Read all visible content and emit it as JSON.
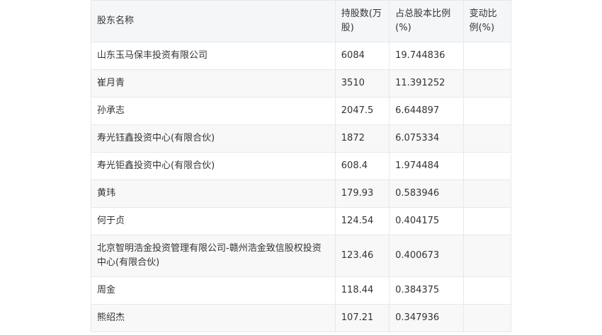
{
  "table": {
    "headers": {
      "name": "股东名称",
      "shares": "持股数(万股)",
      "ratio": "占总股本比例(%)",
      "change": "变动比例(%)"
    },
    "rows": [
      {
        "name": "山东玉马保丰投资有限公司",
        "shares": "6084",
        "ratio": "19.744836",
        "change": ""
      },
      {
        "name": "崔月青",
        "shares": "3510",
        "ratio": "11.391252",
        "change": ""
      },
      {
        "name": "孙承志",
        "shares": "2047.5",
        "ratio": "6.644897",
        "change": ""
      },
      {
        "name": "寿光钰鑫投资中心(有限合伙)",
        "shares": "1872",
        "ratio": "6.075334",
        "change": ""
      },
      {
        "name": "寿光钜鑫投资中心(有限合伙)",
        "shares": "608.4",
        "ratio": "1.974484",
        "change": ""
      },
      {
        "name": "黄玮",
        "shares": "179.93",
        "ratio": "0.583946",
        "change": ""
      },
      {
        "name": "何于贞",
        "shares": "124.54",
        "ratio": "0.404175",
        "change": ""
      },
      {
        "name": "北京智明浩金投资管理有限公司-赣州浩金致信股权投资中心(有限合伙)",
        "shares": "123.46",
        "ratio": "0.400673",
        "change": ""
      },
      {
        "name": "周金",
        "shares": "118.44",
        "ratio": "0.384375",
        "change": ""
      },
      {
        "name": "熊绍杰",
        "shares": "107.21",
        "ratio": "0.347936",
        "change": ""
      }
    ]
  }
}
